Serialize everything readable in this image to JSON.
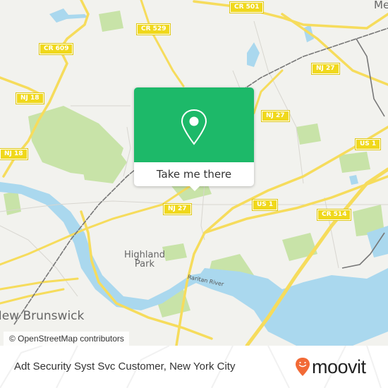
{
  "map": {
    "road_shields": [
      {
        "id": "cr501",
        "label": "CR 501"
      },
      {
        "id": "cr529",
        "label": "CR 529"
      },
      {
        "id": "cr609",
        "label": "CR 609"
      },
      {
        "id": "nj18a",
        "label": "NJ 18"
      },
      {
        "id": "nj18b",
        "label": "NJ 18"
      },
      {
        "id": "nj27a",
        "label": "NJ 27"
      },
      {
        "id": "nj27b",
        "label": "NJ 27"
      },
      {
        "id": "nj27c",
        "label": "NJ 27"
      },
      {
        "id": "us1a",
        "label": "US 1"
      },
      {
        "id": "us1b",
        "label": "US 1"
      },
      {
        "id": "cr514",
        "label": "CR 514"
      }
    ],
    "places": {
      "highland_park_1": "Highland",
      "highland_park_2": "Park",
      "new_brunswick": "New Brunswick",
      "raritan_river": "Raritan River",
      "metuchen_partial": "Me"
    },
    "attribution": "© OpenStreetMap contributors",
    "colors": {
      "land": "#f2f2ee",
      "water": "#aad8ee",
      "park": "#c8e3a8",
      "road": "#f6dc5c",
      "rail": "#777777"
    }
  },
  "popup": {
    "icon": "map-pin-icon",
    "action_label": "Take me there",
    "accent_color": "#1db969"
  },
  "footer": {
    "place_title": "Adt Security Syst Svc Customer, New York City",
    "brand": "moovit",
    "brand_color": "#f26a36"
  }
}
